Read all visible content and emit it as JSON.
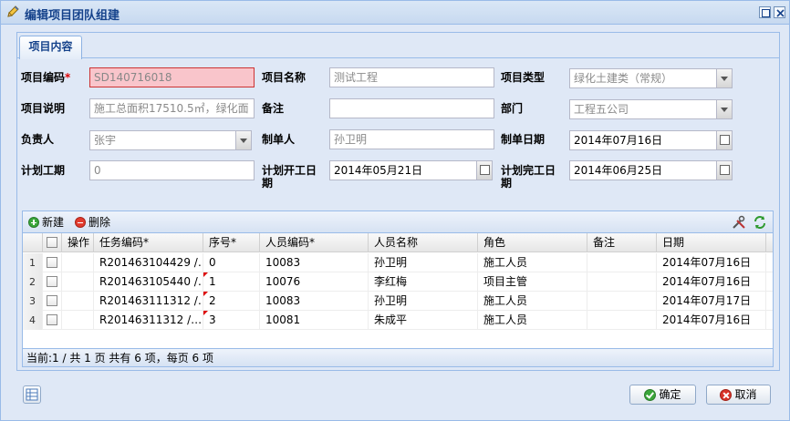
{
  "window": {
    "title": "编辑项目团队组建"
  },
  "tabs": [
    {
      "label": "项目内容"
    }
  ],
  "form": {
    "project_code": {
      "label": "项目编码",
      "required_mark": "*",
      "value": "SD140716018"
    },
    "project_name": {
      "label": "项目名称",
      "value": "测试工程"
    },
    "project_type": {
      "label": "项目类型",
      "value": "绿化土建类（常规）"
    },
    "project_desc": {
      "label": "项目说明",
      "value": "施工总面积17510.5㎡，绿化面"
    },
    "remark": {
      "label": "备注",
      "value": ""
    },
    "department": {
      "label": "部门",
      "value": "工程五公司"
    },
    "manager": {
      "label": "负责人",
      "value": "张宇"
    },
    "creator": {
      "label": "制单人",
      "value": "孙卫明"
    },
    "create_date": {
      "label": "制单日期",
      "value": "2014年07月16日"
    },
    "plan_duration": {
      "label": "计划工期",
      "value": "0"
    },
    "plan_start": {
      "label_line1": "计划开工日",
      "label_line2": "期",
      "value": "2014年05月21日"
    },
    "plan_end": {
      "label_line1": "计划完工日",
      "label_line2": "期",
      "value": "2014年06月25日"
    }
  },
  "grid": {
    "toolbar": {
      "add_label": "新建",
      "delete_label": "删除"
    },
    "columns": [
      "操作",
      "任务编码*",
      "序号*",
      "人员编码*",
      "人员名称",
      "角色",
      "备注",
      "日期"
    ],
    "rows": [
      {
        "num": "1",
        "task_code": "R201463104429 /…",
        "seq": "0",
        "staff_code": "10083",
        "staff_name": "孙卫明",
        "role": "施工人员",
        "remark": "",
        "date": "2014年07月16日"
      },
      {
        "num": "2",
        "task_code": "R201463105440 /…",
        "seq": "1",
        "staff_code": "10076",
        "staff_name": "李红梅",
        "role": "项目主管",
        "remark": "",
        "date": "2014年07月16日"
      },
      {
        "num": "3",
        "task_code": "R201463111312 /…",
        "seq": "2",
        "staff_code": "10083",
        "staff_name": "孙卫明",
        "role": "施工人员",
        "remark": "",
        "date": "2014年07月17日"
      },
      {
        "num": "4",
        "task_code": "R20146311312 /…",
        "seq": "3",
        "staff_code": "10081",
        "staff_name": "朱成平",
        "role": "施工人员",
        "remark": "",
        "date": "2014年07月16日"
      }
    ],
    "paging": "当前:1 / 共 1 页 共有 6 项，每页 6 项"
  },
  "buttons": {
    "ok_label": "确定",
    "cancel_label": "取消"
  },
  "icons": {
    "title": "pencil-icon",
    "add": "add-icon",
    "delete": "delete-icon",
    "tools": "tools-icon",
    "refresh": "refresh-icon",
    "ok": "ok-icon",
    "cancel": "cancel-icon",
    "footer_tool": "table-icon"
  },
  "colors": {
    "title_text": "#15428b",
    "invalid_bg": "#f9c5cb",
    "panel_bg": "#dfe8f6",
    "border": "#99bbe8"
  }
}
